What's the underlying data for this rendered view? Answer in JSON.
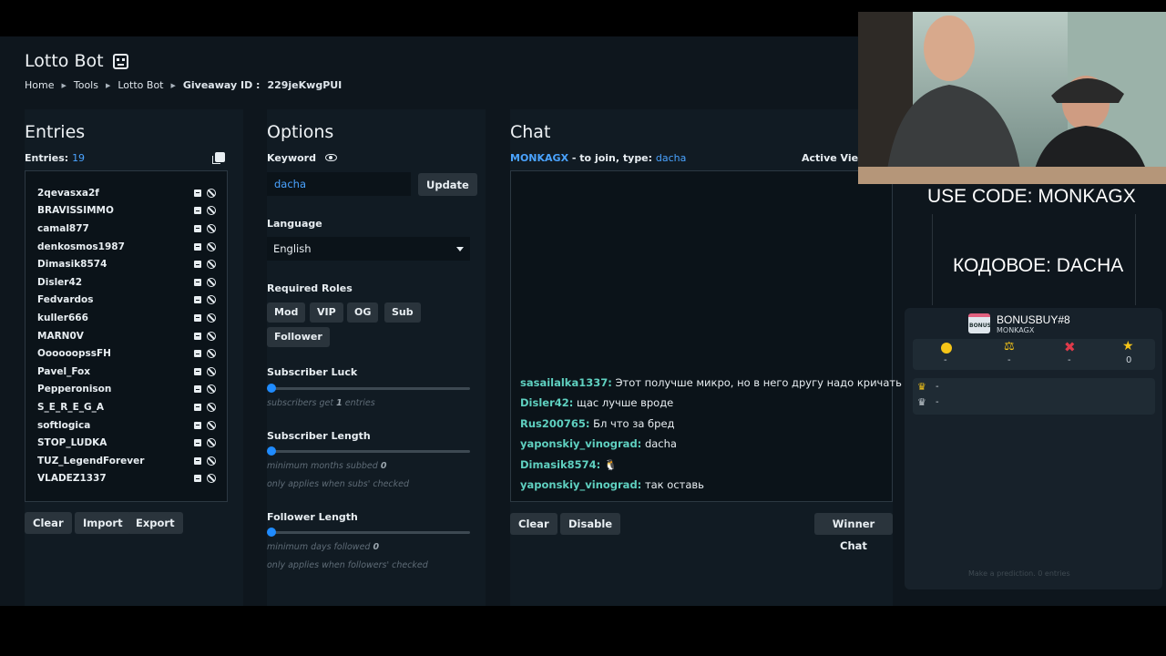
{
  "page": {
    "title": "Lotto Bot",
    "breadcrumbs": [
      "Home",
      "Tools",
      "Lotto Bot"
    ],
    "giveaway_label": "Giveaway ID :",
    "giveaway_id": "229jeKwgPUI"
  },
  "entries": {
    "heading": "Entries",
    "count_label": "Entries:",
    "count": "19",
    "names": [
      "2qevasxa2f",
      "BRAVISSIMMO",
      "camal877",
      "denkosmos1987",
      "Dimasik8574",
      "Disler42",
      "Fedvardos",
      "kuller666",
      "MARN0V",
      "OooooopssFH",
      "Pavel_Fox",
      "Pepperonison",
      "S_E_R_E_G_A",
      "softlogica",
      "STOP_LUDKA",
      "TUZ_LegendForever",
      "VLADEZ1337"
    ],
    "buttons": {
      "clear": "Clear",
      "import": "Import",
      "export": "Export"
    }
  },
  "options": {
    "heading": "Options",
    "keyword_label": "Keyword",
    "keyword_value": "dacha",
    "update_label": "Update",
    "language_label": "Language",
    "language_value": "English",
    "roles_label": "Required Roles",
    "roles": [
      "Mod",
      "VIP",
      "OG",
      "Sub",
      "Follower"
    ],
    "sub_luck_label": "Subscriber Luck",
    "sub_luck_hint_a": "subscribers get",
    "sub_luck_value": "1",
    "sub_luck_hint_b": "entries",
    "sub_length_label": "Subscriber Length",
    "sub_length_hint_a": "minimum months subbed",
    "sub_length_value": "0",
    "sub_length_note": "only applies when subs' checked",
    "follower_length_label": "Follower Length",
    "follower_length_hint_a": "minimum days followed",
    "follower_length_value": "0",
    "follower_length_note": "only applies when followers' checked"
  },
  "chat": {
    "heading": "Chat",
    "channel": "MONKAGX",
    "join_text": "- to join, type:",
    "keyword": "dacha",
    "active_viewers": "Active View",
    "messages": [
      {
        "user": "sasailalka1337:",
        "text": "Этот получше микро, но в него другу надо кричать"
      },
      {
        "user": "Disler42:",
        "text": "щас лучше вроде"
      },
      {
        "user": "Rus200765:",
        "text": "Бл что за бред"
      },
      {
        "user": "yaponskiy_vinograd:",
        "text": "dacha"
      },
      {
        "user": "Dimasik8574:",
        "text": "🐧"
      },
      {
        "user": "yaponskiy_vinograd:",
        "text": "так оставь"
      }
    ],
    "buttons": {
      "clear": "Clear",
      "disable": "Disable",
      "winner_chat": "Winner Chat"
    }
  },
  "overlay": {
    "code_line_1": "USE CODE: MONKAGX",
    "code_line_2": "КОДОВОЕ: DACHA",
    "bonus_title": "BONUSBUY#8",
    "bonus_sub": "MONKAGX",
    "bonus_badge": "BONUS",
    "stats": [
      "-",
      "-",
      "-",
      "0"
    ],
    "leaders": [
      "-",
      "-"
    ],
    "footer": "Make a prediction. 0 entries"
  },
  "colors": {
    "accent": "#4aa3ff",
    "username": "#5fd0c0",
    "slider": "#1f8bff",
    "background": "#0e161d"
  }
}
